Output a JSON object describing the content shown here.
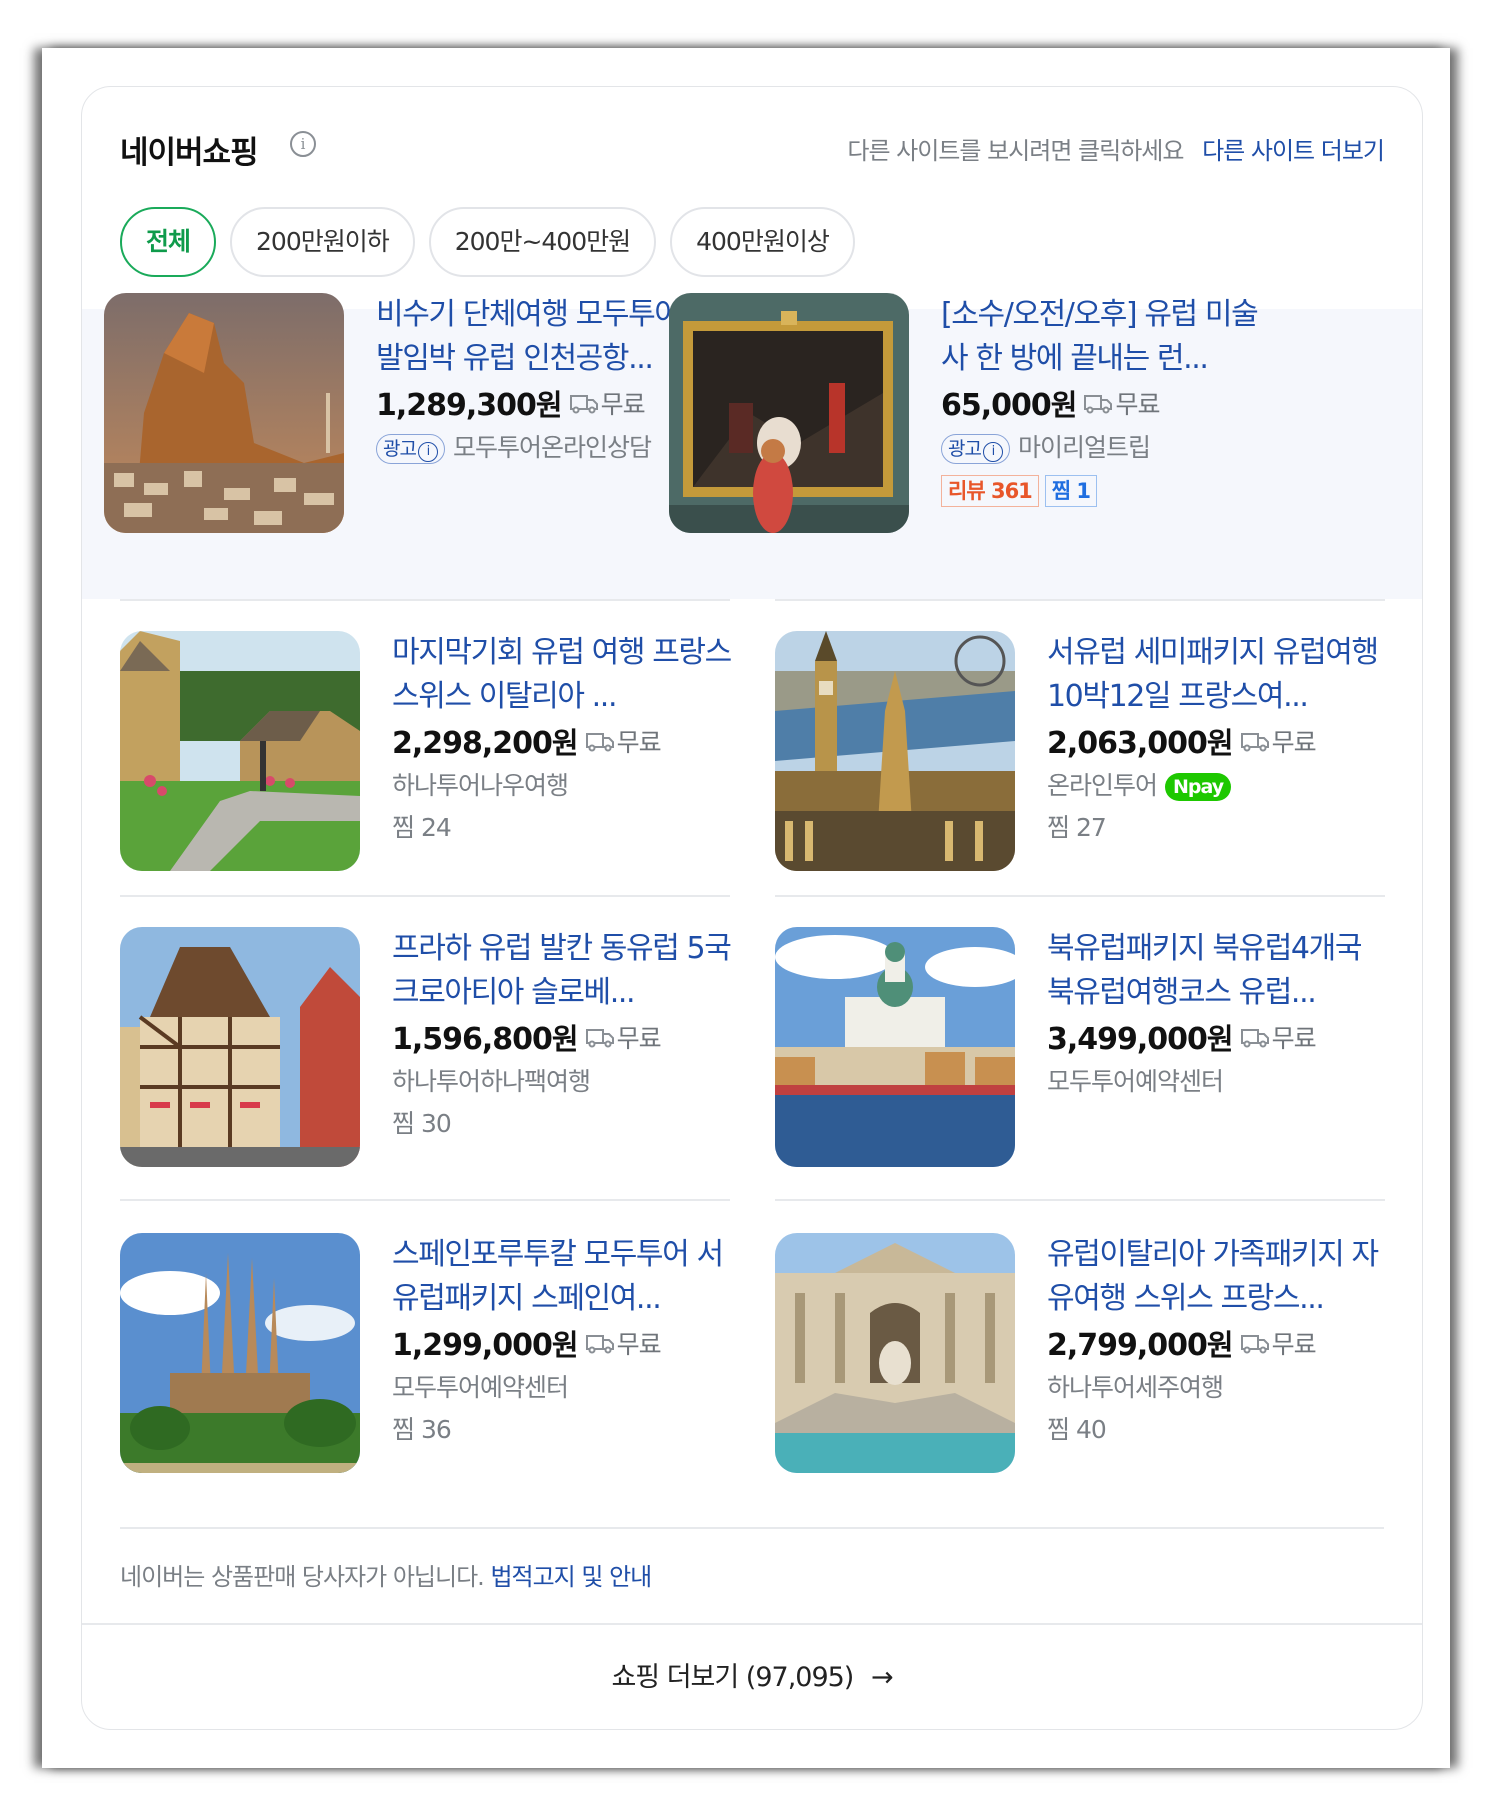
{
  "header": {
    "title": "네이버쇼핑",
    "hint": "다른 사이트를 보시려면 클릭하세요",
    "more_sites": "다른 사이트 더보기"
  },
  "chips": [
    "전체",
    "200만원이하",
    "200만~400만원",
    "400만원이상"
  ],
  "ad_label": "광고",
  "ship_label": "무료",
  "won": "원",
  "products": [
    {
      "title": "비수기 단체여행 모두투어 출발임박 유럽 인천공항...",
      "price": "1,289,300",
      "seller": "모두투어온라인상담",
      "ad": true
    },
    {
      "title": "[소수/오전/오후] 유럽 미술사 한 방에 끝내는 런...",
      "price": "65,000",
      "seller": "마이리얼트립",
      "ad": true,
      "review": "리뷰 361",
      "jjim_tag": "찜 1"
    },
    {
      "title": "마지막기회 유럽 여행 프랑스 스위스 이탈리아 ...",
      "price": "2,298,200",
      "seller": "하나투어나우여행",
      "jjim": "찜 24"
    },
    {
      "title": "서유럽 세미패키지 유럽여행 10박12일 프랑스여...",
      "price": "2,063,000",
      "seller": "온라인투어",
      "npay": "pay",
      "jjim": "찜 27"
    },
    {
      "title": "프라하 유럽 발칸 동유럽 5국 크로아티아 슬로베...",
      "price": "1,596,800",
      "seller": "하나투어하나팩여행",
      "jjim": "찜 30"
    },
    {
      "title": "북유럽패키지 북유럽4개국 북유럽여행코스 유럽...",
      "price": "3,499,000",
      "seller": "모두투어예약센터"
    },
    {
      "title": "스페인포루투칼 모두투어 서유럽패키지 스페인여...",
      "price": "1,299,000",
      "seller": "모두투어예약센터",
      "jjim": "찜 36"
    },
    {
      "title": "유럽이탈리아 가족패키지 자유여행 스위스 프랑스...",
      "price": "2,799,000",
      "seller": "하나투어세주여행",
      "jjim": "찜 40"
    }
  ],
  "legal": {
    "text": "네이버는 상품판매 당사자가 아닙니다.",
    "link": "법적고지 및 안내"
  },
  "more": {
    "label": "쇼핑 더보기 (97,095)"
  }
}
